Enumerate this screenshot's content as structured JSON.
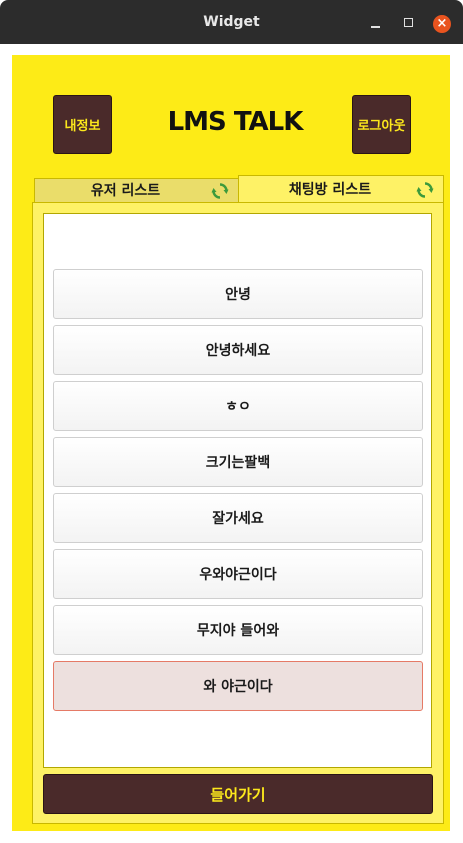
{
  "window": {
    "title": "Widget",
    "close_glyph": "×"
  },
  "header": {
    "app_title": "LMS TALK",
    "my_info_label": "내정보",
    "logout_label": "로그아웃"
  },
  "tabs": [
    {
      "label": "유저 리스트",
      "icon": "refresh-icon",
      "active": false
    },
    {
      "label": "채팅방 리스트",
      "icon": "refresh-icon",
      "active": true
    }
  ],
  "rooms": [
    {
      "name": "안녕"
    },
    {
      "name": "안녕하세요"
    },
    {
      "name": "ㅎㅇ"
    },
    {
      "name": "크기는팔백"
    },
    {
      "name": "잘가세요"
    },
    {
      "name": "우와야근이다"
    },
    {
      "name": "무지야 들어와"
    },
    {
      "name": "와 야근이다",
      "selected": true
    }
  ],
  "footer": {
    "enter_label": "들어가기"
  },
  "colors": {
    "panel": "#fdeb17",
    "button": "#4a2a2a",
    "button_text": "#fce81c",
    "selected": "#ede0de"
  }
}
